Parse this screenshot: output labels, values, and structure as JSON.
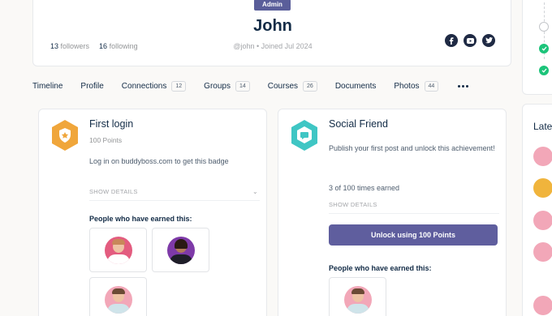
{
  "profile": {
    "role_badge": "Admin",
    "name": "John",
    "followers_count": "13",
    "followers_label": "followers",
    "following_count": "16",
    "following_label": "following",
    "handle_meta": "@john • Joined Jul 2024",
    "socials": [
      "facebook-icon",
      "youtube-icon",
      "twitter-icon"
    ]
  },
  "nav": {
    "items": [
      {
        "label": "Timeline",
        "count": null
      },
      {
        "label": "Profile",
        "count": null
      },
      {
        "label": "Connections",
        "count": "12"
      },
      {
        "label": "Groups",
        "count": "14"
      },
      {
        "label": "Courses",
        "count": "26"
      },
      {
        "label": "Documents",
        "count": null
      },
      {
        "label": "Photos",
        "count": "44"
      }
    ]
  },
  "badges": [
    {
      "title": "First login",
      "points": "100 Points",
      "description": "Log in on buddyboss.com to get this badge",
      "show_details": "SHOW DETAILS",
      "earned_title": "People who have earned this:",
      "color": "#f0a63b"
    },
    {
      "title": "Social Friend",
      "points": "",
      "description": "Publish your first post and unlock this achievement!",
      "progress": "3 of 100 times earned",
      "show_details": "SHOW DETAILS",
      "unlock_button": "Unlock using 100 Points",
      "earned_title": "People who have earned this:",
      "color": "#3fc6c4"
    }
  ],
  "sidebar": {
    "latest_title": "Late"
  },
  "colors": {
    "accent": "#5f5e9e",
    "success": "#1cc47a",
    "text": "#122b46"
  }
}
